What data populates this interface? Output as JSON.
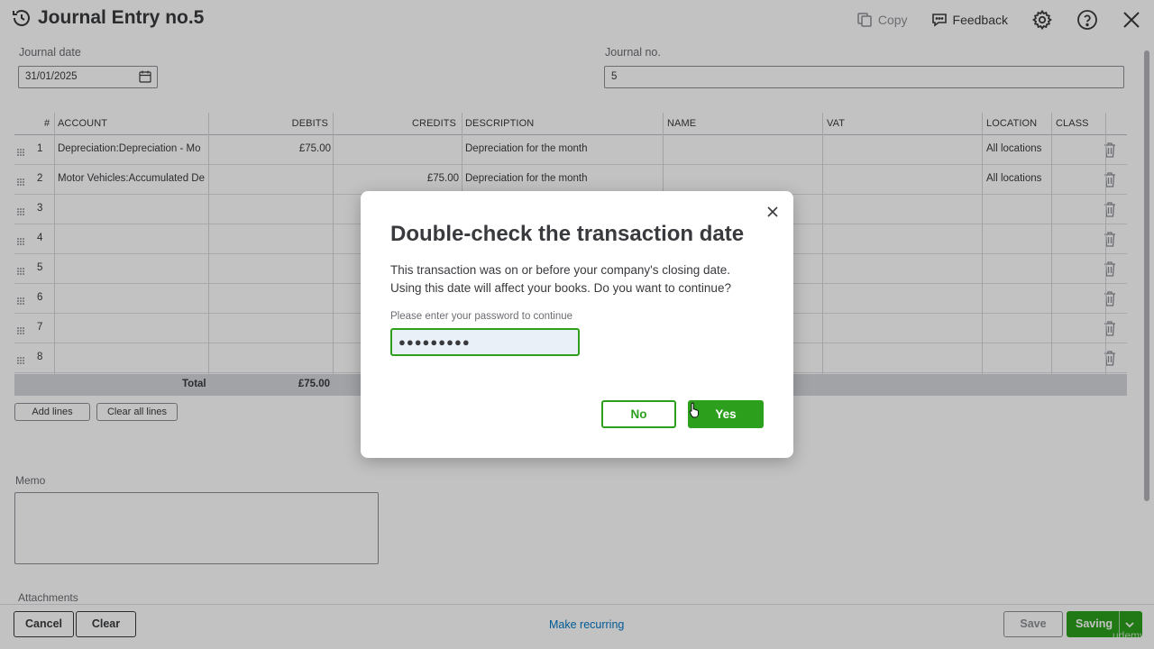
{
  "header": {
    "title": "Journal Entry no.5",
    "copy_label": "Copy",
    "feedback_label": "Feedback"
  },
  "form": {
    "journal_date_label": "Journal date",
    "journal_date_value": "31/01/2025",
    "journal_no_label": "Journal no.",
    "journal_no_value": "5"
  },
  "table": {
    "columns": [
      "#",
      "ACCOUNT",
      "DEBITS",
      "CREDITS",
      "DESCRIPTION",
      "NAME",
      "VAT",
      "LOCATION",
      "CLASS"
    ],
    "rows": [
      {
        "num": "1",
        "account": "Depreciation:Depreciation - Mo",
        "debit": "£75.00",
        "credit": "",
        "description": "Depreciation for the month",
        "name": "",
        "vat": "",
        "location": "All locations",
        "class": ""
      },
      {
        "num": "2",
        "account": "Motor Vehicles:Accumulated De",
        "debit": "",
        "credit": "£75.00",
        "description": "Depreciation for the month",
        "name": "",
        "vat": "",
        "location": "All locations",
        "class": ""
      },
      {
        "num": "3",
        "account": "",
        "debit": "",
        "credit": "",
        "description": "",
        "name": "",
        "vat": "",
        "location": "",
        "class": ""
      },
      {
        "num": "4",
        "account": "",
        "debit": "",
        "credit": "",
        "description": "",
        "name": "",
        "vat": "",
        "location": "",
        "class": ""
      },
      {
        "num": "5",
        "account": "",
        "debit": "",
        "credit": "",
        "description": "",
        "name": "",
        "vat": "",
        "location": "",
        "class": ""
      },
      {
        "num": "6",
        "account": "",
        "debit": "",
        "credit": "",
        "description": "",
        "name": "",
        "vat": "",
        "location": "",
        "class": ""
      },
      {
        "num": "7",
        "account": "",
        "debit": "",
        "credit": "",
        "description": "",
        "name": "",
        "vat": "",
        "location": "",
        "class": ""
      },
      {
        "num": "8",
        "account": "",
        "debit": "",
        "credit": "",
        "description": "",
        "name": "",
        "vat": "",
        "location": "",
        "class": ""
      }
    ],
    "total_label": "Total",
    "total_debit": "£75.00",
    "add_lines_label": "Add lines",
    "clear_all_lines_label": "Clear all lines"
  },
  "memo_label": "Memo",
  "attachments_label": "Attachments",
  "footer": {
    "cancel_label": "Cancel",
    "clear_label": "Clear",
    "make_recurring_label": "Make recurring",
    "save_label": "Save",
    "saving_label": "Saving",
    "watermark": "udemy"
  },
  "dialog": {
    "title": "Double-check the transaction date",
    "message_line1": "This transaction was on or before your company's closing date.",
    "message_line2": "Using this date will affect your books. Do you want to continue?",
    "password_label": "Please enter your password to continue",
    "password_value": "●●●●●●●●●",
    "no_label": "No",
    "yes_label": "Yes"
  },
  "colors": {
    "accent_green": "#2ca01c",
    "link_blue": "#0077c5",
    "text": "#393a3d"
  },
  "icons": [
    "history-icon",
    "copy-icon",
    "feedback-icon",
    "gear-icon",
    "help-icon",
    "close-icon",
    "calendar-icon",
    "drag-handle-icon",
    "trash-icon",
    "chevron-down-icon"
  ]
}
